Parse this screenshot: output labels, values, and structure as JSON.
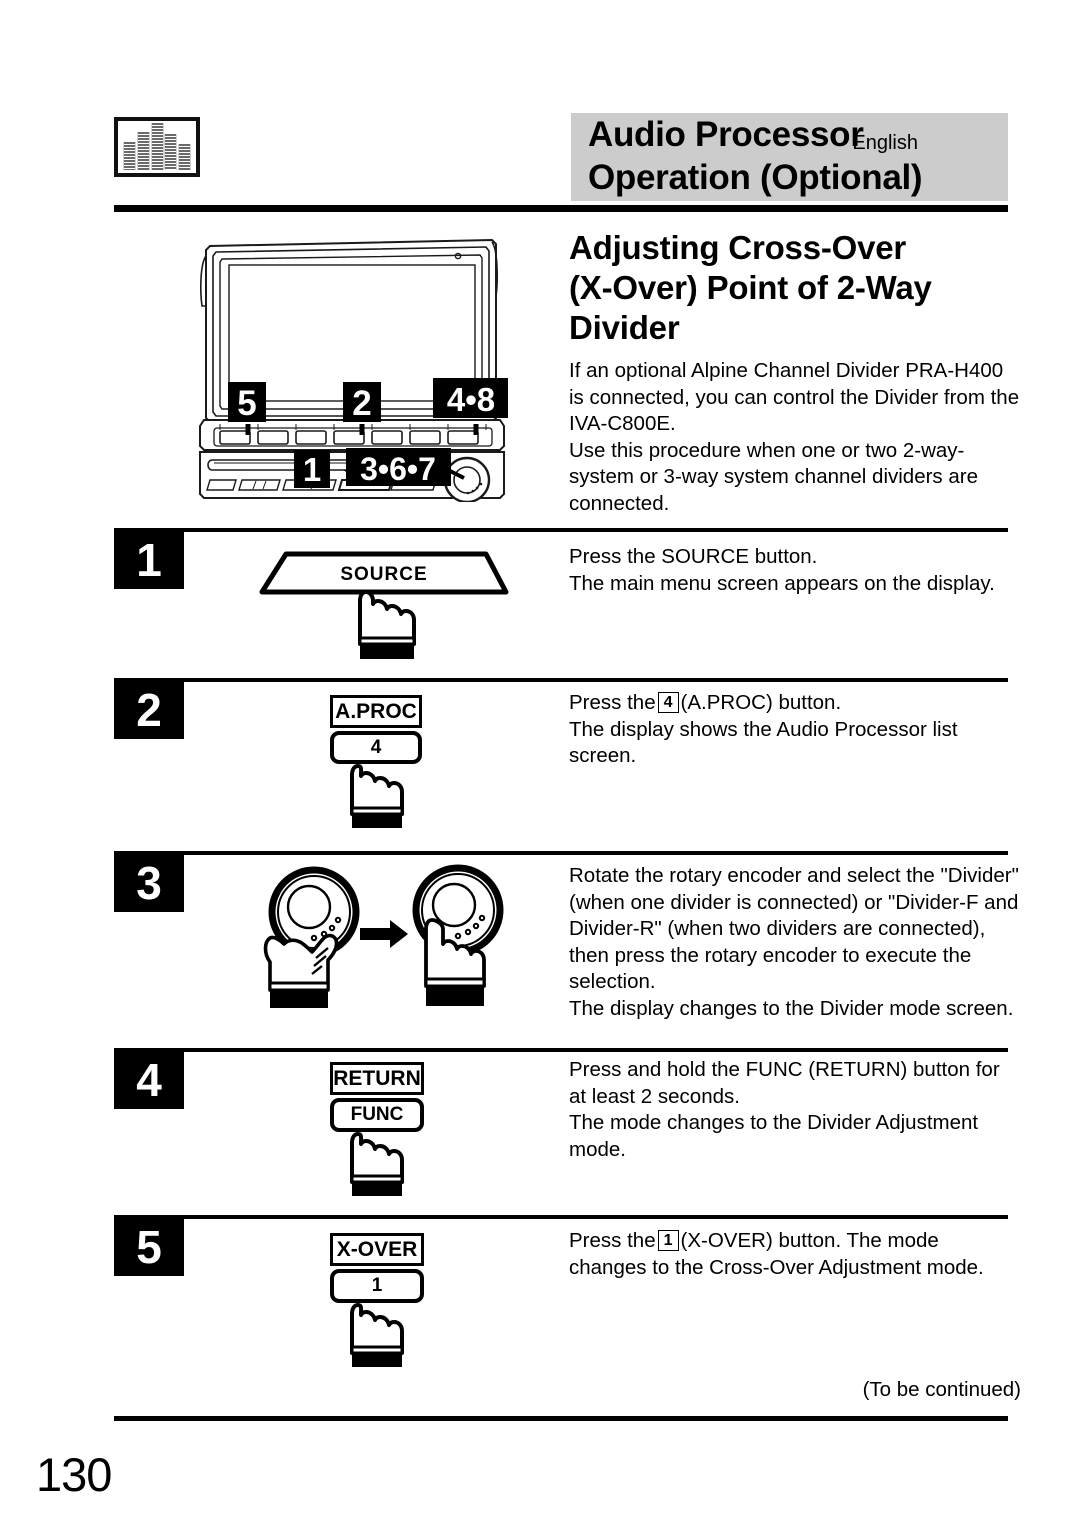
{
  "header": {
    "icon": "equalizer-icon",
    "title_line1": "Audio Processor",
    "title_line2": "Operation (Optional)",
    "language": "English",
    "band_color": "#cccccc"
  },
  "section": {
    "title_line1": "Adjusting Cross-Over",
    "title_line2": "(X-Over) Point of 2-Way",
    "title_line3": "Divider",
    "intro": "If an optional Alpine Channel Divider PRA-H400 is connected, you can control the Divider from the IVA-C800E.\nUse this procedure when one or two 2-way-system or 3-way system channel dividers are connected."
  },
  "device": {
    "name": "car-head-unit-illustration",
    "callouts": [
      {
        "label": "5",
        "target": "upper-button-1"
      },
      {
        "label": "2",
        "target": "upper-button-4"
      },
      {
        "label": "4•8",
        "target": "upper-button-7"
      },
      {
        "label": "1",
        "target": "lower-open-button"
      },
      {
        "label": "3•6•7",
        "target": "rotary-encoder"
      }
    ]
  },
  "steps": [
    {
      "number": "1",
      "figure": {
        "type": "trapezoid-button",
        "label": "SOURCE",
        "hand": "pointing-finger"
      },
      "text": "Press the SOURCE button.\nThe main menu screen appears on the display."
    },
    {
      "number": "2",
      "figure": {
        "type": "labeled-button",
        "label": "A.PROC",
        "button": "4",
        "hand": "pointing-finger"
      },
      "text_before": "Press the",
      "text_badge": "4",
      "text_after": "(A.PROC) button.\nThe display shows the Audio Processor list screen."
    },
    {
      "number": "3",
      "figure": {
        "type": "rotary-encoder-pair",
        "left": "hand-rotating-knob",
        "arrow": "right-arrow",
        "right": "hand-pressing-knob"
      },
      "text": "Rotate the rotary encoder and select the \"Divider\" (when one divider is connected) or \"Divider-F and Divider-R\" (when two dividers are connected), then press the rotary encoder to execute the selection.\nThe display changes to the Divider mode screen."
    },
    {
      "number": "4",
      "figure": {
        "type": "labeled-button",
        "label": "RETURN",
        "button": "FUNC",
        "hand": "pointing-finger"
      },
      "text": "Press and hold the FUNC (RETURN) button for at least 2 seconds.\nThe mode changes to the Divider Adjustment mode."
    },
    {
      "number": "5",
      "figure": {
        "type": "labeled-button",
        "label": "X-OVER",
        "button": "1",
        "hand": "pointing-finger"
      },
      "text_before": "Press the",
      "text_badge": "1",
      "text_after": "(X-OVER) button. The mode changes to the Cross-Over Adjustment mode."
    }
  ],
  "footer": {
    "continued": "(To be continued)",
    "page_number": "130"
  }
}
